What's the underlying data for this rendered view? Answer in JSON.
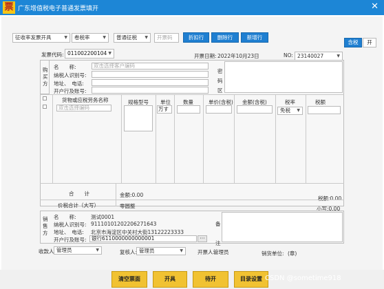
{
  "window": {
    "title": "广东增值税电子普通发票填开",
    "logo_char": "票"
  },
  "toolbar": {
    "dropdown1": "征收率发票开具",
    "dropdown2": "卷税率",
    "dropdown3": "普通征税",
    "dropdown4_placeholder": "开票码",
    "discount": "折扣行",
    "delete_row": "删除行",
    "add_row": "新增行",
    "tax_incl": "含税",
    "tax_toggle": "开"
  },
  "invoice": {
    "code_label": "发票代码:",
    "code": "011002200104",
    "date_label": "开票日期:",
    "date": "2022年10月23日",
    "no_label": "NO:",
    "no": "23140027"
  },
  "buyer": {
    "side": "购买方",
    "name_label": "名　　称:",
    "name_placeholder": "双击选择客户编码",
    "taxid_label": "纳税人识别号:",
    "addr_label": "地址、　电话:",
    "bank_label": "开户行及账号:",
    "secret_side": "密码区"
  },
  "items": {
    "headers": [
      "货物或应税劳务名称",
      "规格型号",
      "单位",
      "数量",
      "单价(含税)",
      "金额(含税)",
      "税率",
      "税额"
    ],
    "row1_name_placeholder": "双击选择编码",
    "row1_unit": "万す",
    "row1_rate": "免税"
  },
  "totals": {
    "sum_label": "合　　计",
    "amount": "金额:0.00",
    "tax": "税额:0.00",
    "total_label": "价税合计（大写）",
    "total_upper": "零圆整",
    "total_lower": "小写:0.00"
  },
  "seller": {
    "side": "销售方",
    "name_label": "名　　称:",
    "name": "测试0001",
    "taxid_label": "纳税人识别号:",
    "taxid": "91110101202206271643",
    "addr_label": "地址、　电话:",
    "addr": "北京市海淀区中关村大街13122223333",
    "bank_label": "开户行及账号:",
    "bank": "银行6110000000000001",
    "remark_side": "备注"
  },
  "signers": {
    "payee_label": "收款人:",
    "payee": "管理员",
    "reviewer_label": "复核人:",
    "reviewer": "管理员",
    "drawer_label": "开票人:",
    "drawer": "管理员",
    "seller_seal_label": "销货单位:",
    "seller_seal": "(章)"
  },
  "bottom": {
    "clear": "清空票面",
    "issue": "开具",
    "pending": "待开",
    "catalog": "目录设置",
    "watermark": "CSDN @sometime918"
  },
  "colors": {
    "title_bar": "#1d86d6",
    "button_blue": "#1f7fd1",
    "button_yellow": "#f1c232"
  }
}
